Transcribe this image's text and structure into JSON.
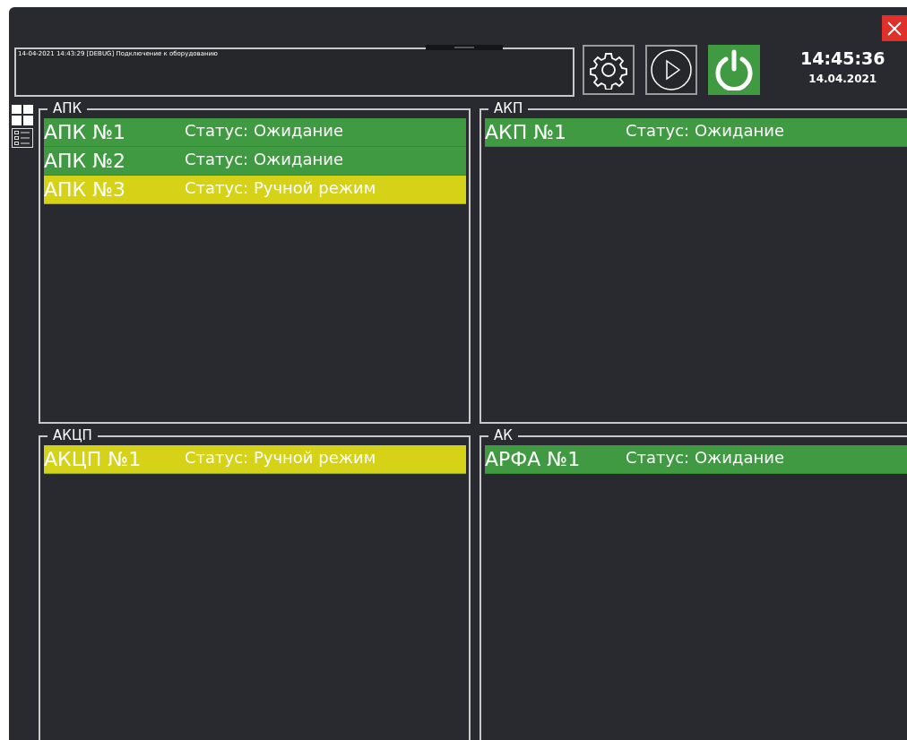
{
  "log": {
    "entries": [
      "14-04-2021 14:43:29 [DEBUG] Подключение к оборудованию"
    ]
  },
  "toolbar": {
    "buttons": [
      {
        "kind": "settings",
        "active": false
      },
      {
        "kind": "play",
        "active": false
      },
      {
        "kind": "power",
        "active": true
      }
    ]
  },
  "clock": {
    "time": "14:45:36",
    "date": "14.04.2021"
  },
  "view_switcher": [
    {
      "kind": "tiles"
    },
    {
      "kind": "list"
    }
  ],
  "groups": [
    {
      "title": "АПК",
      "items": [
        {
          "name": "АПК №1",
          "status": "Статус: Ожидание",
          "color": "#3f9a41"
        },
        {
          "name": "АПК №2",
          "status": "Статус: Ожидание",
          "color": "#3f9a41"
        },
        {
          "name": "АПК №3",
          "status": "Статус: Ручной режим",
          "color": "#d5d218"
        }
      ]
    },
    {
      "title": "АКП",
      "items": [
        {
          "name": "АКП №1",
          "status": "Статус: Ожидание",
          "color": "#3f9a41"
        }
      ]
    },
    {
      "title": "АКЦП",
      "items": [
        {
          "name": "АКЦП №1",
          "status": "Статус: Ручной режим",
          "color": "#d5d218"
        }
      ]
    },
    {
      "title": "АК",
      "items": [
        {
          "name": "АРФА №1",
          "status": "Статус: Ожидание",
          "color": "#3f9a41"
        }
      ]
    }
  ]
}
